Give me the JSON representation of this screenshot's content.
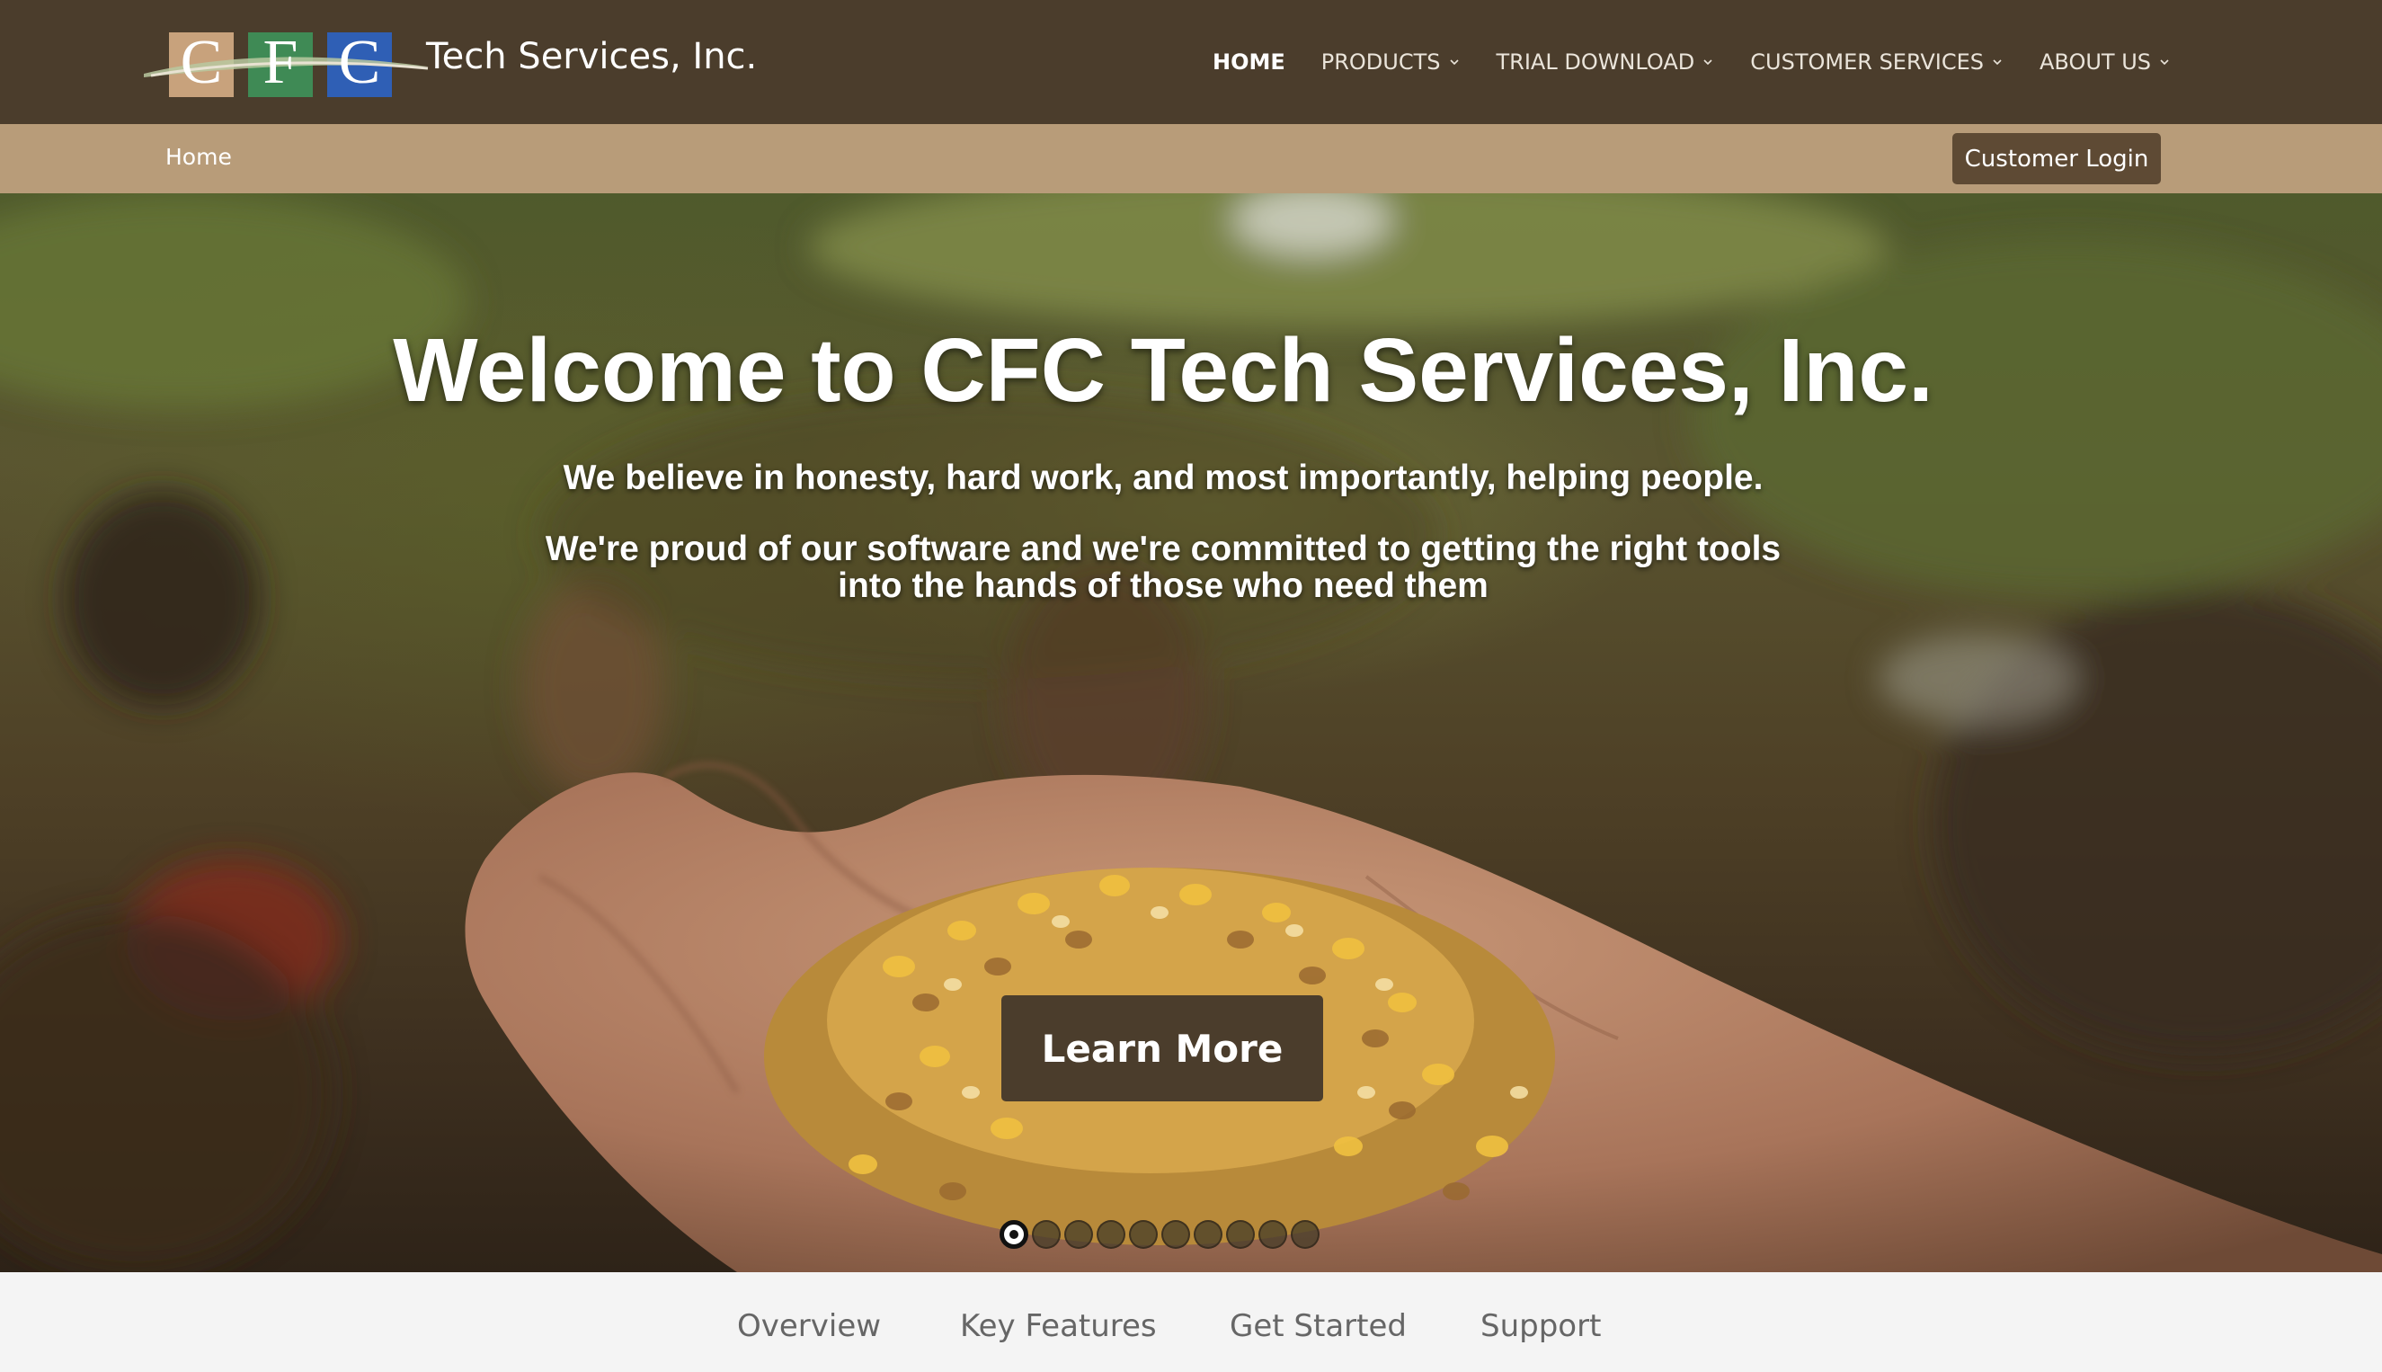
{
  "brand": {
    "logo_letters": [
      "C",
      "F",
      "C"
    ],
    "name": "Tech Services, Inc.",
    "colors": {
      "c1": "#c8a27c",
      "f": "#3f8a55",
      "c2": "#2f5fb5"
    }
  },
  "nav": {
    "items": [
      {
        "label": "HOME",
        "active": true,
        "has_dropdown": false
      },
      {
        "label": "PRODUCTS",
        "active": false,
        "has_dropdown": true
      },
      {
        "label": "TRIAL DOWNLOAD",
        "active": false,
        "has_dropdown": true
      },
      {
        "label": "CUSTOMER SERVICES",
        "active": false,
        "has_dropdown": true
      },
      {
        "label": "ABOUT US",
        "active": false,
        "has_dropdown": true
      }
    ]
  },
  "breadcrumb": {
    "current": "Home"
  },
  "login": {
    "label": "Customer Login"
  },
  "hero": {
    "title": "Welcome to CFC Tech Services, Inc.",
    "line1": "We believe in honesty, hard work, and most importantly, helping people.",
    "line2a": "We're proud of our software and we're committed to getting the right tools",
    "line2b": "into the hands of those who need them",
    "cta": "Learn More",
    "slide_count": 10,
    "active_slide": 1
  },
  "tabs": [
    "Overview",
    "Key Features",
    "Get Started",
    "Support"
  ],
  "theme": {
    "primary": "#4b3d2c",
    "secondary": "#b89c79",
    "button": "#5e4a34"
  }
}
